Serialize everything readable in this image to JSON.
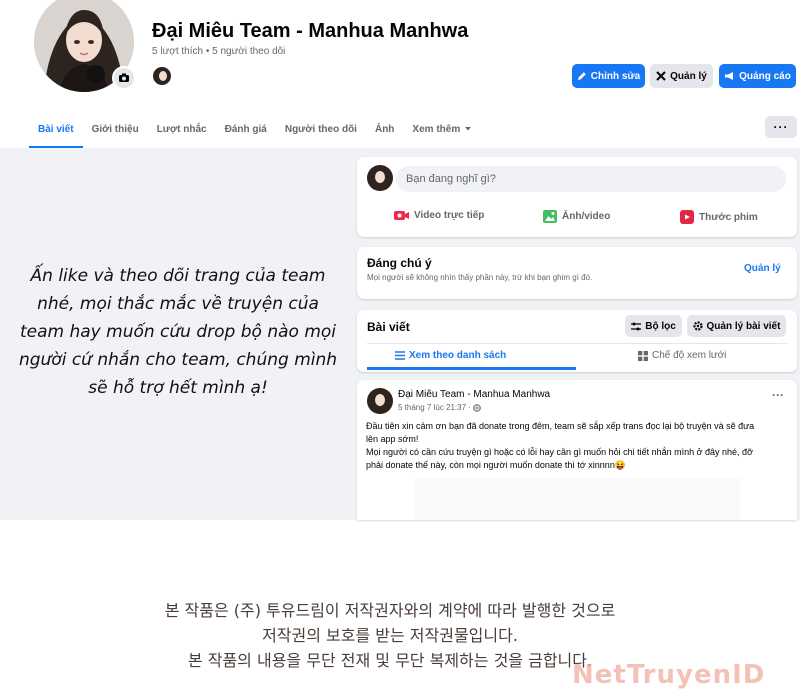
{
  "page": {
    "title": "Đại Miêu Team - Manhua Manhwa",
    "stats": "5 lượt thích • 5 người theo dõi"
  },
  "header_buttons": {
    "edit": "Chỉnh sửa",
    "manage": "Quản lý",
    "ads": "Quảng cáo"
  },
  "tabs": [
    {
      "label": "Bài viết",
      "active": true
    },
    {
      "label": "Giới thiệu"
    },
    {
      "label": "Lượt nhắc"
    },
    {
      "label": "Đánh giá"
    },
    {
      "label": "Người theo dõi"
    },
    {
      "label": "Ảnh"
    },
    {
      "label": "Xem thêm"
    }
  ],
  "notice": {
    "lines": [
      "Ấn like và theo dõi trang của team",
      "nhé, mọi thắc mắc về truyện của",
      "team hay muốn cứu drop bộ nào mọi",
      "người cứ nhắn cho team, chúng mình",
      "sẽ hỗ trợ hết mình ạ!"
    ]
  },
  "composer": {
    "placeholder": "Bạn đang nghĩ gì?",
    "live": "Video trực tiếp",
    "photo": "Ảnh/video",
    "reel": "Thước phim"
  },
  "featured": {
    "title": "Đáng chú ý",
    "desc": "Mọi người sẽ không nhìn thấy phần này, trừ khi bạn ghim gì đó.",
    "manage": "Quản lý"
  },
  "posts_section": {
    "title": "Bài viết",
    "filter": "Bộ lọc",
    "manage": "Quản lý bài viết",
    "list_view": "Xem theo danh sách",
    "grid_view": "Chế độ xem lưới"
  },
  "post": {
    "author": "Đại Miêu Team - Manhua Manhwa",
    "time": "5 tháng 7 lúc 21:37 ·",
    "lines": [
      "Đầu tiên xin cảm ơn bạn đã donate trong đêm, team sẽ sắp xếp trans đọc lại bộ truyện và sẽ đưa",
      "lên app sớm!",
      "Mọi người có cần cứu truyện gì hoặc có lỗi hay cần gì muốn hỏi chi tiết nhắn mình ở đây nhé, đỡ",
      "phải donate thế này, còn mọi người muốn donate thì tớ xinnnn😝"
    ]
  },
  "copyright": {
    "lines": [
      "본 작품은 (주) 투유드림이 저작권자와의 계약에 따라 발행한 것으로",
      "저작권의 보호를 받는 저작권물입니다.",
      "본 작품의 내용을 무단 전재 및 무단 복제하는 것을 금합니다."
    ]
  },
  "watermark": "NetTruyenID",
  "colors": {
    "accent": "#1877f2",
    "gray_bg": "#f0f2f5",
    "live_red": "#f02849",
    "photo_green": "#45bd62",
    "reel_pink": "#e42645"
  }
}
